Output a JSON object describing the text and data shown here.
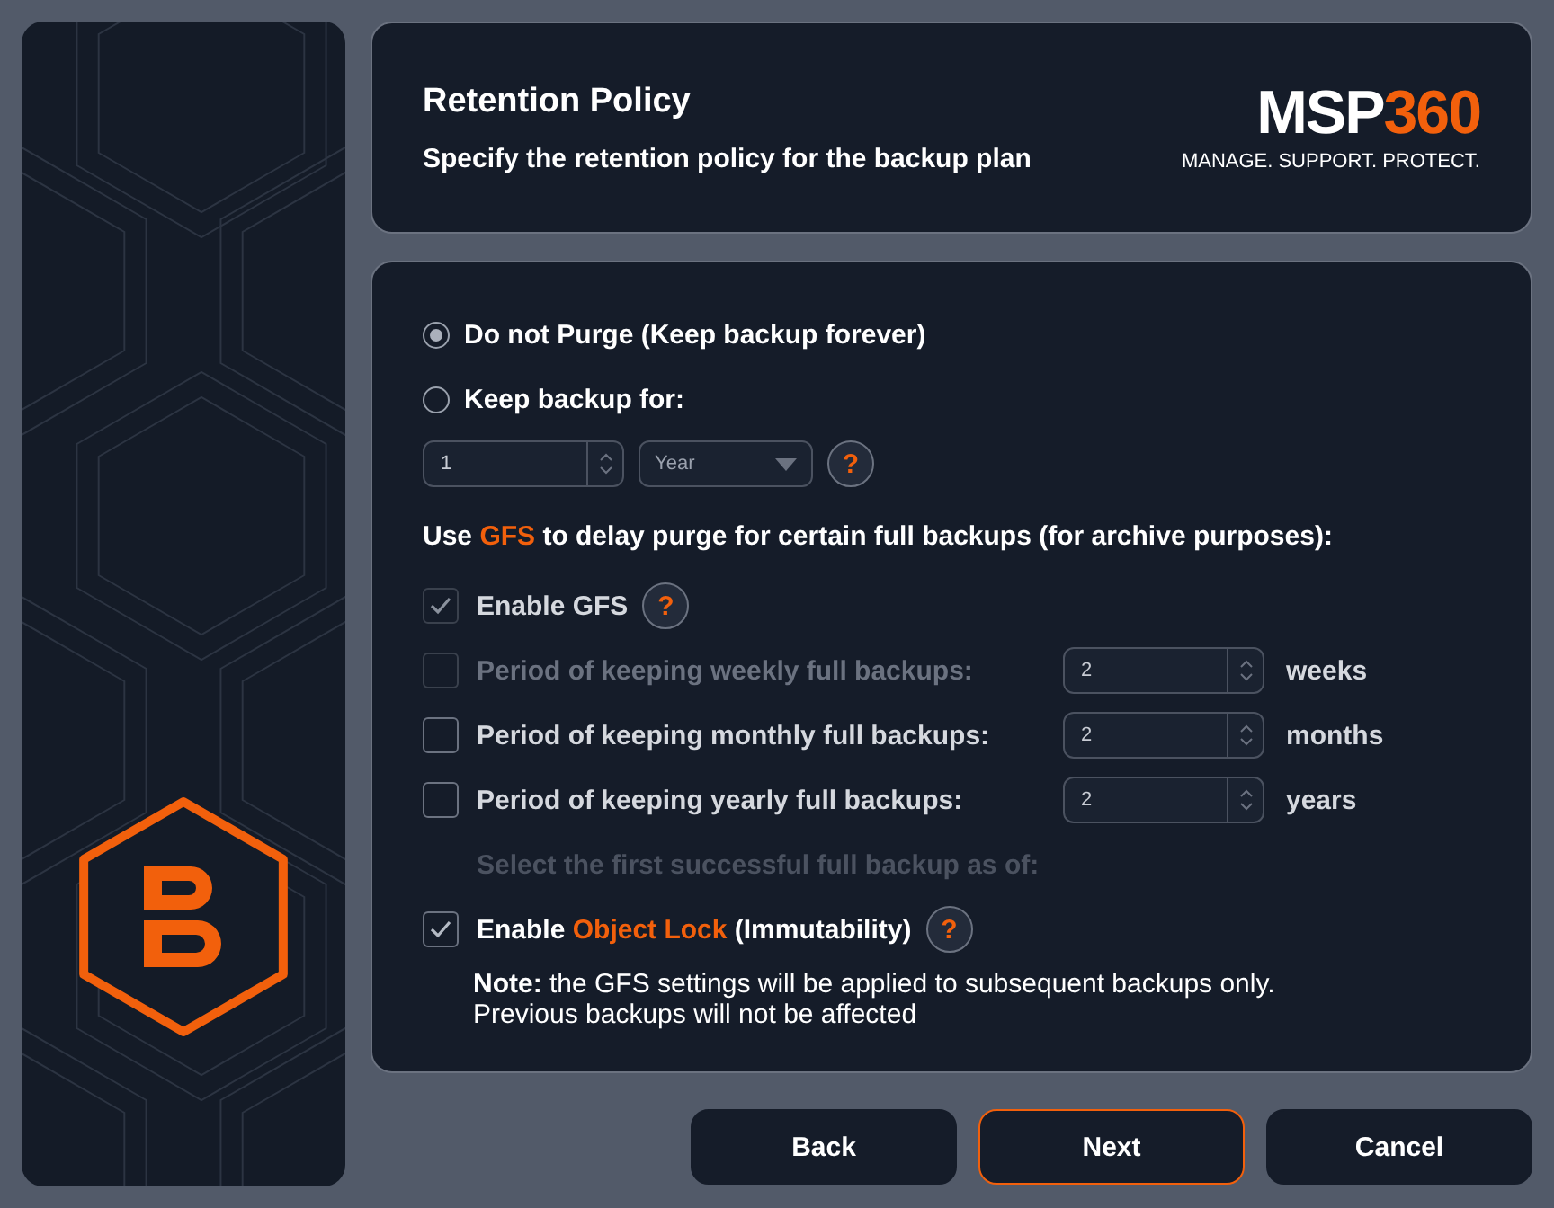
{
  "header": {
    "title": "Retention Policy",
    "subtitle": "Specify the retention policy for the backup plan",
    "logo": {
      "brand": "MSP",
      "accent": "360",
      "tagline": "MANAGE. SUPPORT. PROTECT."
    }
  },
  "retention_options": [
    {
      "label": "Do not Purge (Keep backup forever)",
      "selected": true
    },
    {
      "label": "Keep backup for:",
      "selected": false
    }
  ],
  "keep_for": {
    "value": "1",
    "unit": "Year",
    "help": "?"
  },
  "gfs_heading": {
    "before": "Use ",
    "highlight": "GFS",
    "after": " to delay purge for certain full backups (for archive purposes):"
  },
  "enable_gfs": {
    "label": "Enable GFS",
    "checked": true,
    "disabled": true,
    "help": "?"
  },
  "periods": [
    {
      "label": "Period of keeping weekly full backups:",
      "checked": false,
      "disabled": true,
      "value": "2",
      "unit": "weeks"
    },
    {
      "label": "Period of keeping monthly full backups:",
      "checked": false,
      "disabled": false,
      "value": "2",
      "unit": "months"
    },
    {
      "label": "Period of keeping yearly full backups:",
      "checked": false,
      "disabled": false,
      "value": "2",
      "unit": "years"
    }
  ],
  "first_backup": {
    "label": "Select the first successful full backup as of:",
    "disabled": true
  },
  "object_lock": {
    "before": "Enable ",
    "highlight": "Object Lock",
    "after": " (Immutability)",
    "checked": true,
    "help": "?"
  },
  "note": "**Note:** the GFS settings will be applied to subsequent backups only.\nPrevious backups will not be affected",
  "buttons": [
    {
      "label": "Back",
      "primary": false
    },
    {
      "label": "Next",
      "primary": true
    },
    {
      "label": "Cancel",
      "primary": false
    }
  ]
}
